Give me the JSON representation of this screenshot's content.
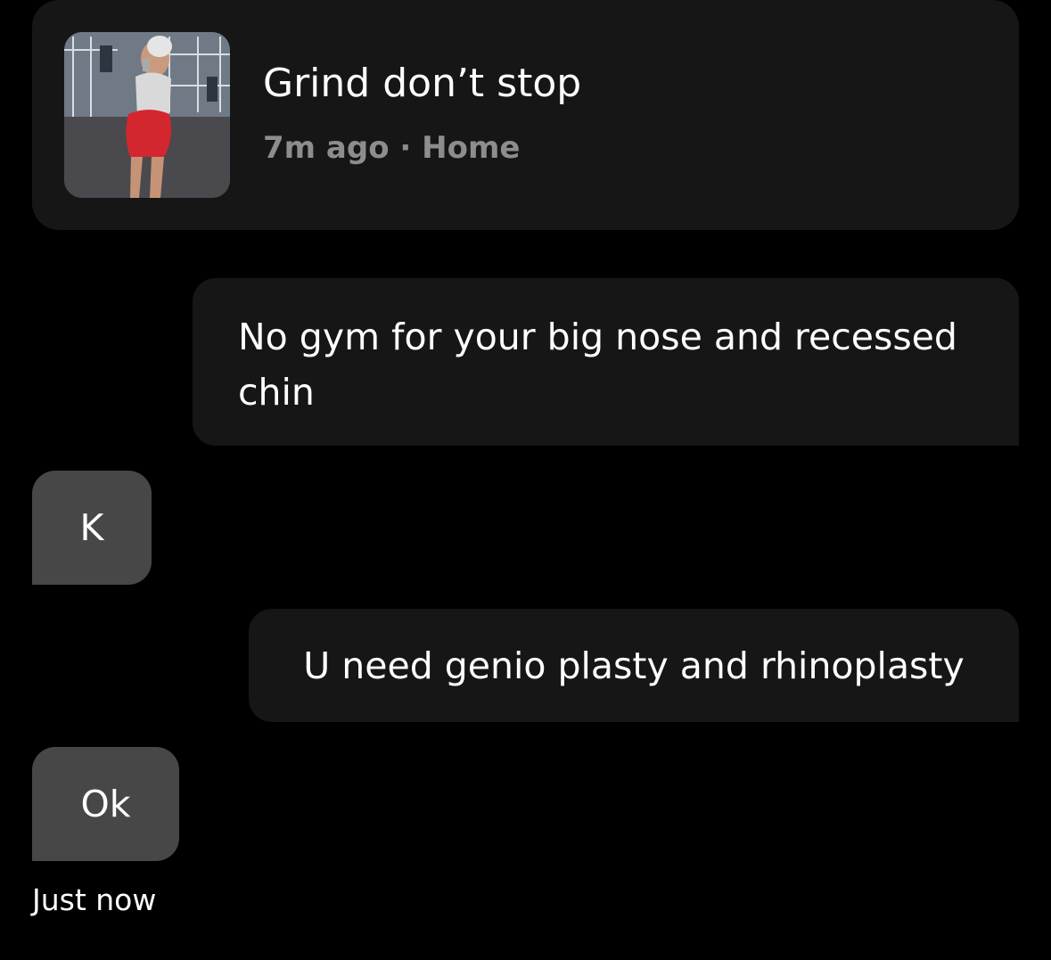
{
  "story": {
    "title": "Grind don’t stop",
    "meta": "7m ago · Home",
    "thumbnail": "gym-selfie-photo"
  },
  "messages": [
    {
      "direction": "sent",
      "text": "No gym for your big nose and recessed chin"
    },
    {
      "direction": "received",
      "text": "K"
    },
    {
      "direction": "sent",
      "text": "U need genio plasty and rhinoplasty"
    },
    {
      "direction": "received",
      "text": "Ok"
    }
  ],
  "timestamp": "Just now",
  "colors": {
    "background": "#000000",
    "sent_bubble": "#161616",
    "received_bubble": "#474747",
    "meta_text": "#8d8d8d",
    "text": "#ffffff"
  }
}
